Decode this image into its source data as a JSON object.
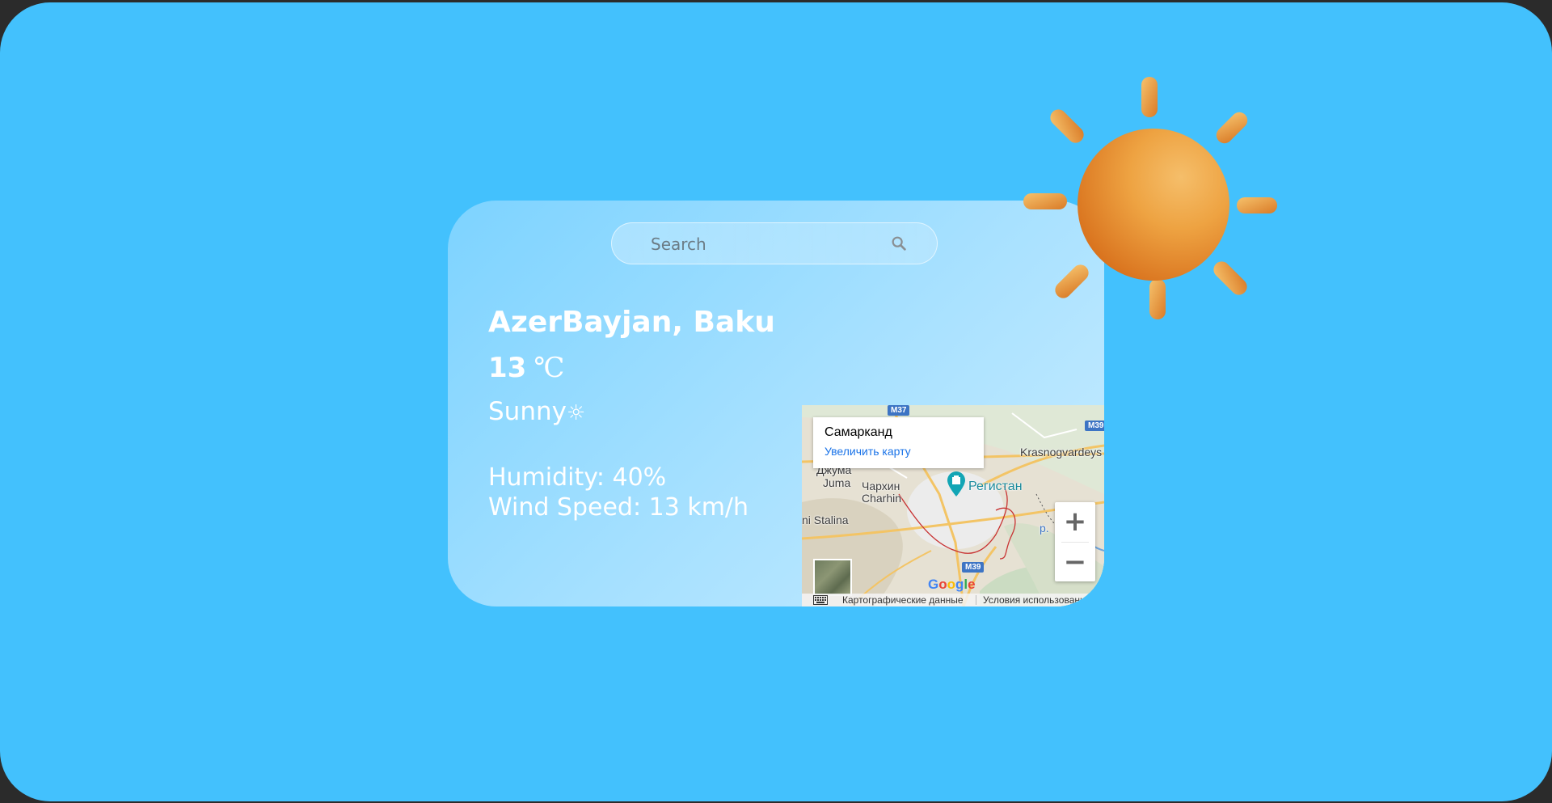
{
  "search": {
    "placeholder": "Search"
  },
  "weather": {
    "location": "AzerBayjan, Baku",
    "temperature": "13",
    "unit": "℃",
    "condition": "Sunny",
    "condition_icon": "☼",
    "humidity": "Humidity: 40%",
    "wind": "Wind Speed: 13 km/h"
  },
  "map": {
    "info_title": "Самарканд",
    "info_link": "Увеличить карту",
    "labels": {
      "krasnogvardeys": "Krasnogvardeys",
      "dzhuma": "Джума",
      "juma": "Juma",
      "charkhin": "Чархин",
      "charhin": "Charhin",
      "stalina": "ni Stalina",
      "registan": "Регистан",
      "river": "р."
    },
    "road_badges": {
      "m37": "M37",
      "m39_top": "M39",
      "m39_bottom": "M39"
    },
    "zoom_in": "+",
    "zoom_out": "−",
    "google": "Google",
    "footer_data": "Картографические данные",
    "footer_terms": "Условия использования"
  },
  "colors": {
    "background": "#43c1fd",
    "text": "#ffffff",
    "link": "#1a73e8"
  }
}
